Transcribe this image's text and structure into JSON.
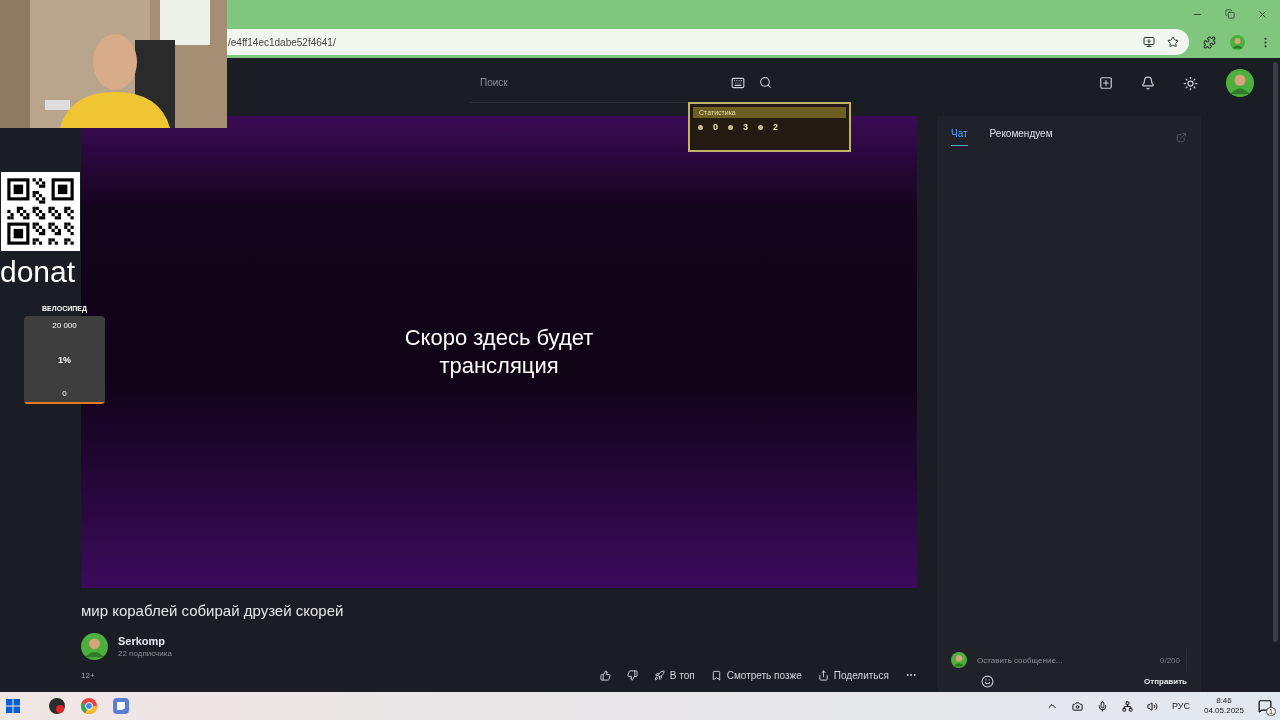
{
  "browser": {
    "url": "/e4ff14ec1dabe52f4641/"
  },
  "header": {
    "search": {
      "placeholder": "Поиск"
    }
  },
  "overlays": {
    "donate_label": "donat",
    "goal": {
      "title": "ВЕЛОСИПЕД",
      "target": "20 000",
      "percent": "1%",
      "current": "0",
      "level": 0.01
    },
    "stats": {
      "title": "Статистика",
      "values": [
        "0",
        "3",
        "2"
      ]
    }
  },
  "video": {
    "message": "Скоро здесь будет трансляция"
  },
  "stream": {
    "title": "мир кораблей собирай друзей скорей",
    "channel": {
      "name": "Serkomp",
      "subscribers": "22 подписчика"
    },
    "age_rating": "12+",
    "actions": [
      {
        "kind": "like"
      },
      {
        "kind": "dislike"
      },
      {
        "kind": "top",
        "label": "В топ"
      },
      {
        "kind": "later",
        "label": "Смотреть позже"
      },
      {
        "kind": "share",
        "label": "Поделиться"
      },
      {
        "kind": "more"
      }
    ]
  },
  "chat": {
    "tabs": [
      {
        "label": "Чат",
        "selected": true
      },
      {
        "label": "Рекомендуем",
        "selected": false
      }
    ],
    "input": {
      "placeholder": "Оставить сообщение...",
      "counter": "0/200"
    },
    "send": "Отправить"
  },
  "taskbar": {
    "language": "РУС",
    "time": "8:46",
    "date": "04.05.2025",
    "notifications": "1"
  }
}
